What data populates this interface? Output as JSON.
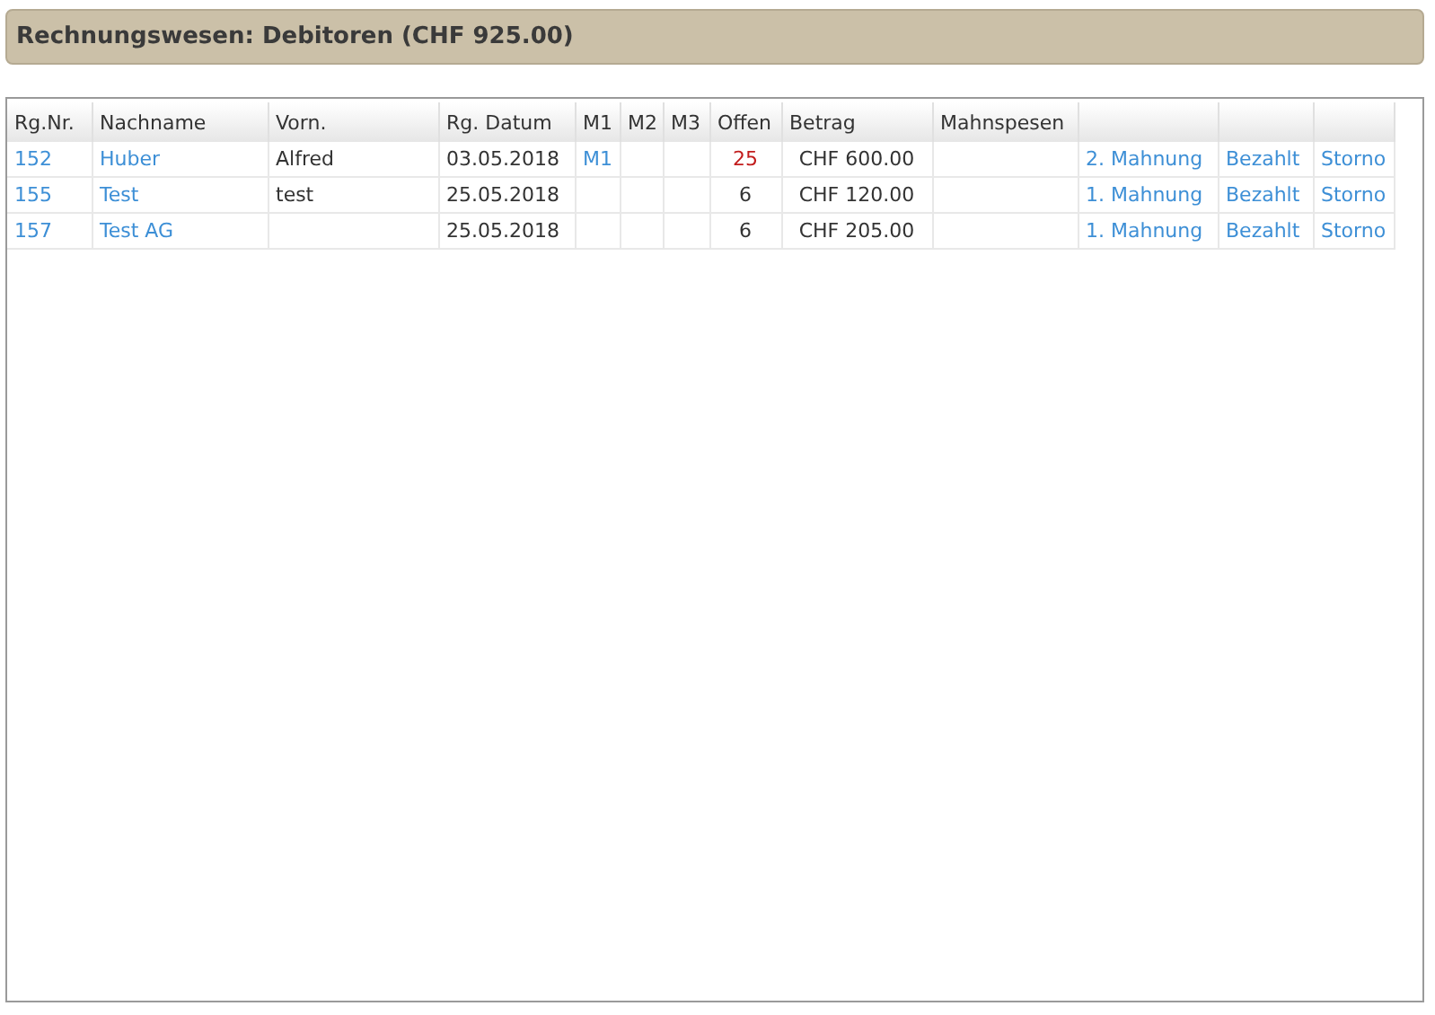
{
  "header": {
    "title": "Rechnungswesen: Debitoren (CHF 925.00)"
  },
  "table": {
    "columns": [
      "Rg.Nr.",
      "Nachname",
      "Vorn.",
      "Rg. Datum",
      "M1",
      "M2",
      "M3",
      "Offen",
      "Betrag",
      "Mahnspesen"
    ],
    "rows": [
      {
        "number": "152",
        "last_name": "Huber",
        "first_name": "Alfred",
        "date": "03.05.2018",
        "m1": "M1",
        "offen": "25",
        "overdue": true,
        "betrag": "CHF 600.00",
        "reminder": "2. Mahnung",
        "paid": "Bezahlt",
        "cancel": "Storno"
      },
      {
        "number": "155",
        "last_name": "Test",
        "first_name": "test",
        "date": "25.05.2018",
        "offen": "6",
        "overdue": false,
        "betrag": "CHF 120.00",
        "reminder": "1. Mahnung",
        "paid": "Bezahlt",
        "cancel": "Storno"
      },
      {
        "number": "157",
        "last_name": "Test AG",
        "date": "25.05.2018",
        "offen": "6",
        "overdue": false,
        "betrag": "CHF 205.00",
        "reminder": "1. Mahnung",
        "paid": "Bezahlt",
        "cancel": "Storno"
      }
    ]
  }
}
